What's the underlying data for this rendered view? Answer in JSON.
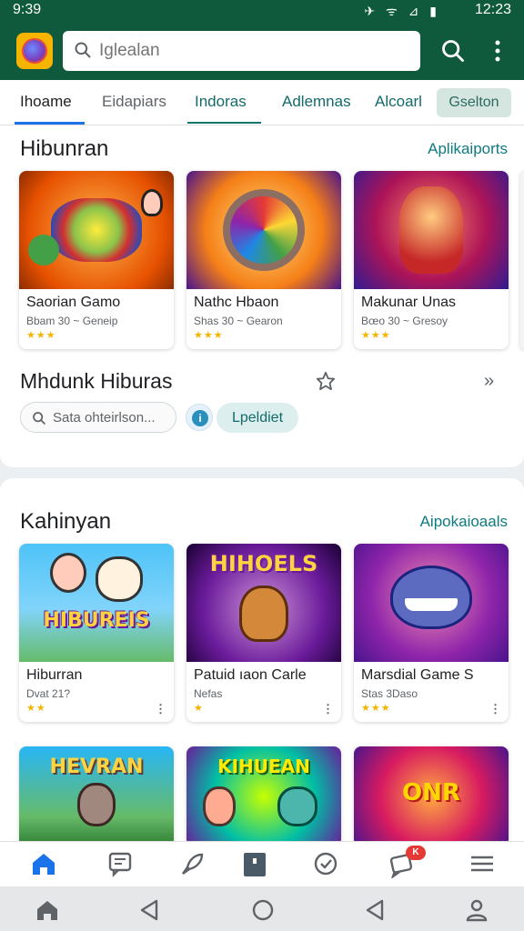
{
  "status_bar": {
    "time_left": "9:39",
    "time_right": "12:23",
    "icons": "✈ ᯤ ⊿ ▮"
  },
  "app_bar": {
    "search_placeholder": "Iglealan",
    "logo_icon": "compass-logo",
    "search_icon": "search-icon",
    "more_icon": "more-vert-icon"
  },
  "tabs": [
    {
      "label": "Ihoame"
    },
    {
      "label": "Eidapiars"
    },
    {
      "label": "Indoras"
    },
    {
      "label": "Adlemnas"
    },
    {
      "label": "Alcoarl"
    },
    {
      "label": "Gselton"
    }
  ],
  "section1": {
    "title": "Hibunran",
    "link": "Aplikaiports",
    "cards": [
      {
        "name": "Saorian Gamo",
        "meta": "Bbam 30 ~ Geneip",
        "stars": "★★★",
        "art": "orange",
        "art_label": ""
      },
      {
        "name": "Nathc Hbaon",
        "meta": "Shas 30 ~ Gearon",
        "stars": "★★★",
        "art": "gold",
        "art_label": ""
      },
      {
        "name": "Makunar Unas",
        "meta": "Bœo 30 ~ Gresoy",
        "stars": "★★★",
        "art": "purple",
        "art_label": ""
      }
    ],
    "subrow": {
      "title": "Mhdunk Hiburas",
      "star_icon": "star-outline-icon",
      "chevron": "»",
      "search_placeholder": "Sata ohteirlson...",
      "info_icon": "i",
      "update_label": "Lpeldiet"
    }
  },
  "section2": {
    "title": "Kahinyan",
    "link": "Aipokaioaals",
    "cards": [
      {
        "name": "Hiburran",
        "meta": "Dvat 21?",
        "stars": "★★",
        "more": "⋮",
        "art": "sky",
        "art_label": "HIBUREIS"
      },
      {
        "name": "Patuid ıaon Carle",
        "meta": "Nefas",
        "stars": "★",
        "more": "⋮",
        "art": "violet",
        "art_label": "HIHOELS"
      },
      {
        "name": "Marsdial Game S",
        "meta": "Stas 3Daso",
        "stars": "★★★",
        "more": "⋮",
        "art": "magenta",
        "art_label": ""
      }
    ],
    "cards_row2": [
      {
        "art": "green",
        "art_label": "HEVRAN"
      },
      {
        "art": "lime",
        "art_label": "KIHUEAN"
      },
      {
        "art": "pink",
        "art_label": "ONR"
      }
    ]
  },
  "bottom_nav": {
    "items": [
      "home-icon",
      "chat-icon",
      "rocket-icon",
      "book-icon",
      "history-icon",
      "notification-icon",
      "menu-icon"
    ],
    "badge": "K"
  },
  "system_nav": {
    "items": [
      "home-icon",
      "back-icon",
      "circle-icon",
      "recent-icon",
      "profile-icon"
    ]
  },
  "colors": {
    "brand": "#0f5a3c",
    "accent": "#1a73e8",
    "link": "#0f7a80"
  }
}
